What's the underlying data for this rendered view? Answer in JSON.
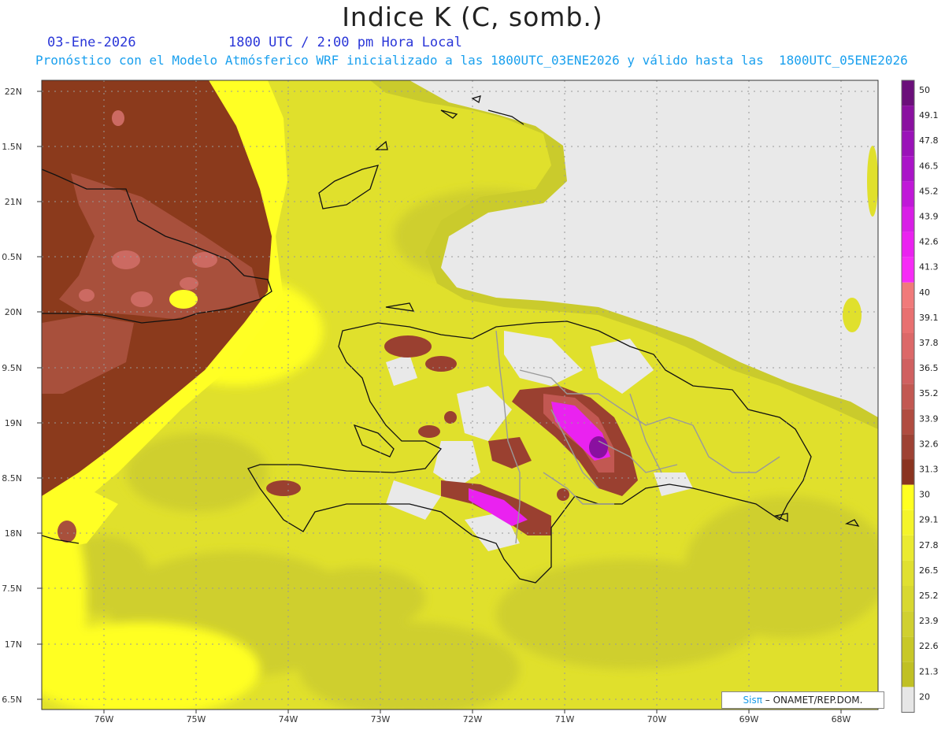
{
  "title": "Indice K (C, somb.)",
  "date": "03-Ene-2026",
  "time": "1800 UTC / 2:00 pm Hora Local",
  "subtitle": "Pronóstico con el Modelo Atmósferico WRF inicializado a las 1800UTC_03ENE2026 y válido hasta las  1800UTC_05ENE2026",
  "credit": {
    "brand": "Sisπ",
    "org": " – ONAMET/REP.DOM."
  },
  "axes": {
    "lat_labels": [
      "22N",
      "1.5N",
      "21N",
      "0.5N",
      "20N",
      "9.5N",
      "19N",
      "8.5N",
      "18N",
      "7.5N",
      "17N",
      "6.5N"
    ],
    "lon_labels": [
      "76W",
      "75W",
      "74W",
      "73W",
      "72W",
      "71W",
      "70W",
      "69W",
      "68W"
    ]
  },
  "colorbar": {
    "labels": [
      "50",
      "49.1",
      "47.8",
      "46.5",
      "45.2",
      "43.9",
      "42.6",
      "41.3",
      "40",
      "39.1",
      "37.8",
      "36.5",
      "35.2",
      "33.9",
      "32.6",
      "31.3",
      "30",
      "29.1",
      "27.8",
      "26.5",
      "25.2",
      "23.9",
      "22.6",
      "21.3",
      "20"
    ],
    "colors": [
      "#6b0f7a",
      "#8a10a0",
      "#9a12b8",
      "#aa14c8",
      "#c018d8",
      "#d81ee6",
      "#ea22f0",
      "#f62cf6",
      "#f07a7a",
      "#e87070",
      "#dc6868",
      "#d06060",
      "#c25852",
      "#b04c40",
      "#9e4234",
      "#8a3420",
      "#ffff20",
      "#f4f42a",
      "#eaea30",
      "#e0e030",
      "#d8d830",
      "#d0d030",
      "#c8c828",
      "#c0c024",
      "#e6e6e6"
    ],
    "ticks": [
      "50",
      "49.1",
      "47.8",
      "46.5",
      "45.2",
      "43.9",
      "42.6",
      "41.3",
      "40",
      "39.1",
      "37.8",
      "36.5",
      "35.2",
      "33.9",
      "32.6",
      "31.3",
      "30",
      "29.1",
      "27.8",
      "26.5",
      "25.2",
      "23.9",
      "22.6",
      "21.3",
      "20"
    ]
  },
  "colors": {
    "brown": "#8b3a1c",
    "brown_light": "#b05542",
    "salmon": "#d6706c",
    "yellow": "#ffff24",
    "yellow_mid": "#e2e22a",
    "olive": "#c9c82e",
    "gray": "#e8e8e8",
    "magenta": "#ee22f0",
    "purple": "#8a10a0"
  }
}
